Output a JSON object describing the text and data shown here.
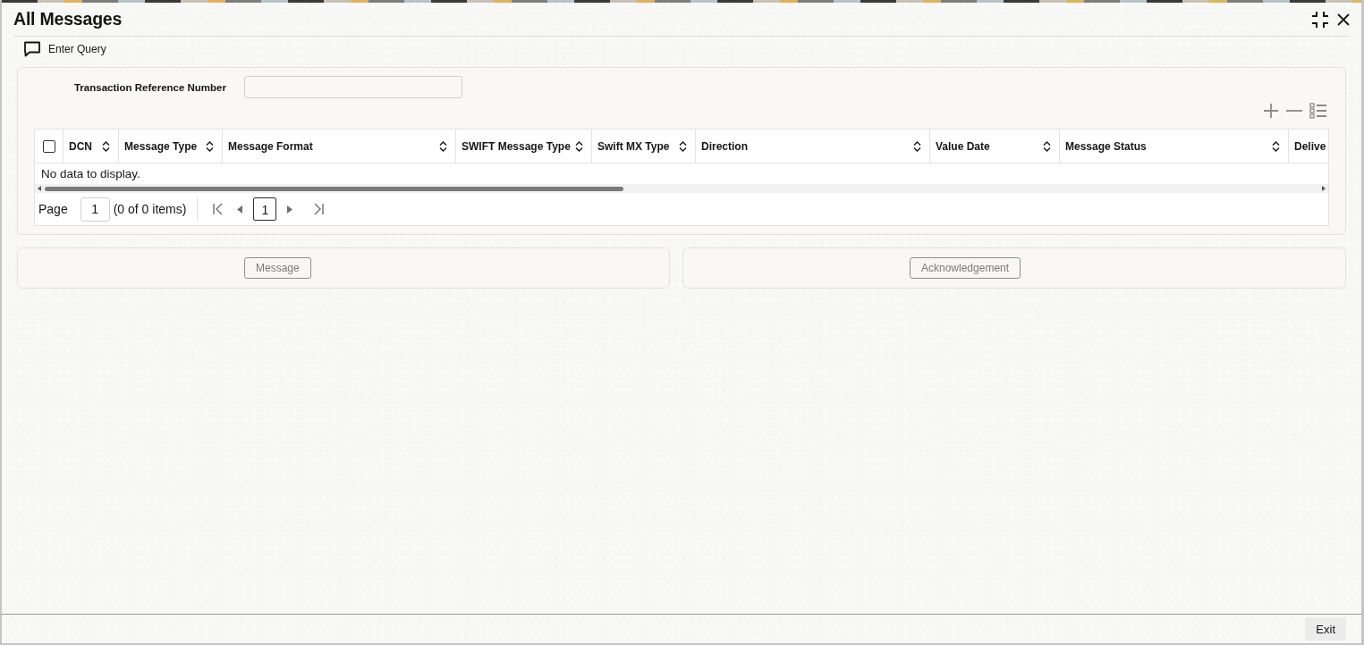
{
  "window": {
    "title": "All Messages"
  },
  "toolbar": {
    "enter_query": "Enter Query"
  },
  "query_form": {
    "fields": [
      {
        "label": "Transaction Reference Number"
      }
    ]
  },
  "table": {
    "select_all": {
      "checked": false
    },
    "columns": [
      "DCN",
      "Message Type",
      "Message Format",
      "SWIFT Message Type",
      "Swift MX Type",
      "Direction",
      "Value Date",
      "Message Status",
      "Delive"
    ],
    "empty_message": "No data to display."
  },
  "pagination": {
    "label": "Page",
    "page_input": "1",
    "summary": "(0 of 0 items)",
    "pages": [
      {
        "label": "1",
        "selected": true
      }
    ]
  },
  "actions": [
    {
      "label": "Message",
      "disabled": true
    },
    {
      "label": "Acknowledgement",
      "disabled": true
    }
  ],
  "footer": {
    "buttons": [
      "Exit"
    ]
  }
}
